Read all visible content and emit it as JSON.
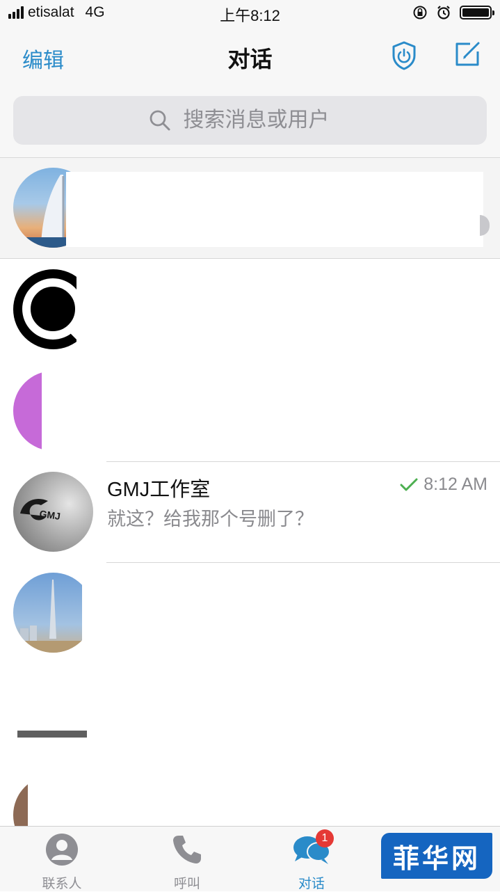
{
  "status_bar": {
    "carrier": "etisalat",
    "network": "4G",
    "time": "上午8:12"
  },
  "nav": {
    "edit_label": "编辑",
    "title": "对话"
  },
  "search": {
    "placeholder": "搜索消息或用户"
  },
  "chats": [
    {
      "name": "",
      "preview": "",
      "time": ""
    },
    {
      "name": "",
      "preview": "",
      "time": ""
    },
    {
      "name": "",
      "preview": "",
      "time": ""
    },
    {
      "name": "GMJ工作室",
      "preview": "就这？给我那个号删了？",
      "time": "8:12 AM",
      "status": "sent-check"
    },
    {
      "name": "",
      "preview": "",
      "time": ""
    },
    {
      "name": "",
      "preview": "",
      "time": ""
    },
    {
      "name": "",
      "preview": "",
      "time": ""
    }
  ],
  "tabbar": {
    "tabs": [
      {
        "label": "联系人",
        "icon": "contacts-icon"
      },
      {
        "label": "呼叫",
        "icon": "phone-icon"
      },
      {
        "label": "对话",
        "icon": "chats-icon",
        "badge": "1",
        "active": true
      }
    ]
  },
  "watermark": {
    "text": "菲华网"
  },
  "colors": {
    "accent": "#2a8bc9",
    "check": "#4caf50",
    "badge": "#e53935"
  }
}
